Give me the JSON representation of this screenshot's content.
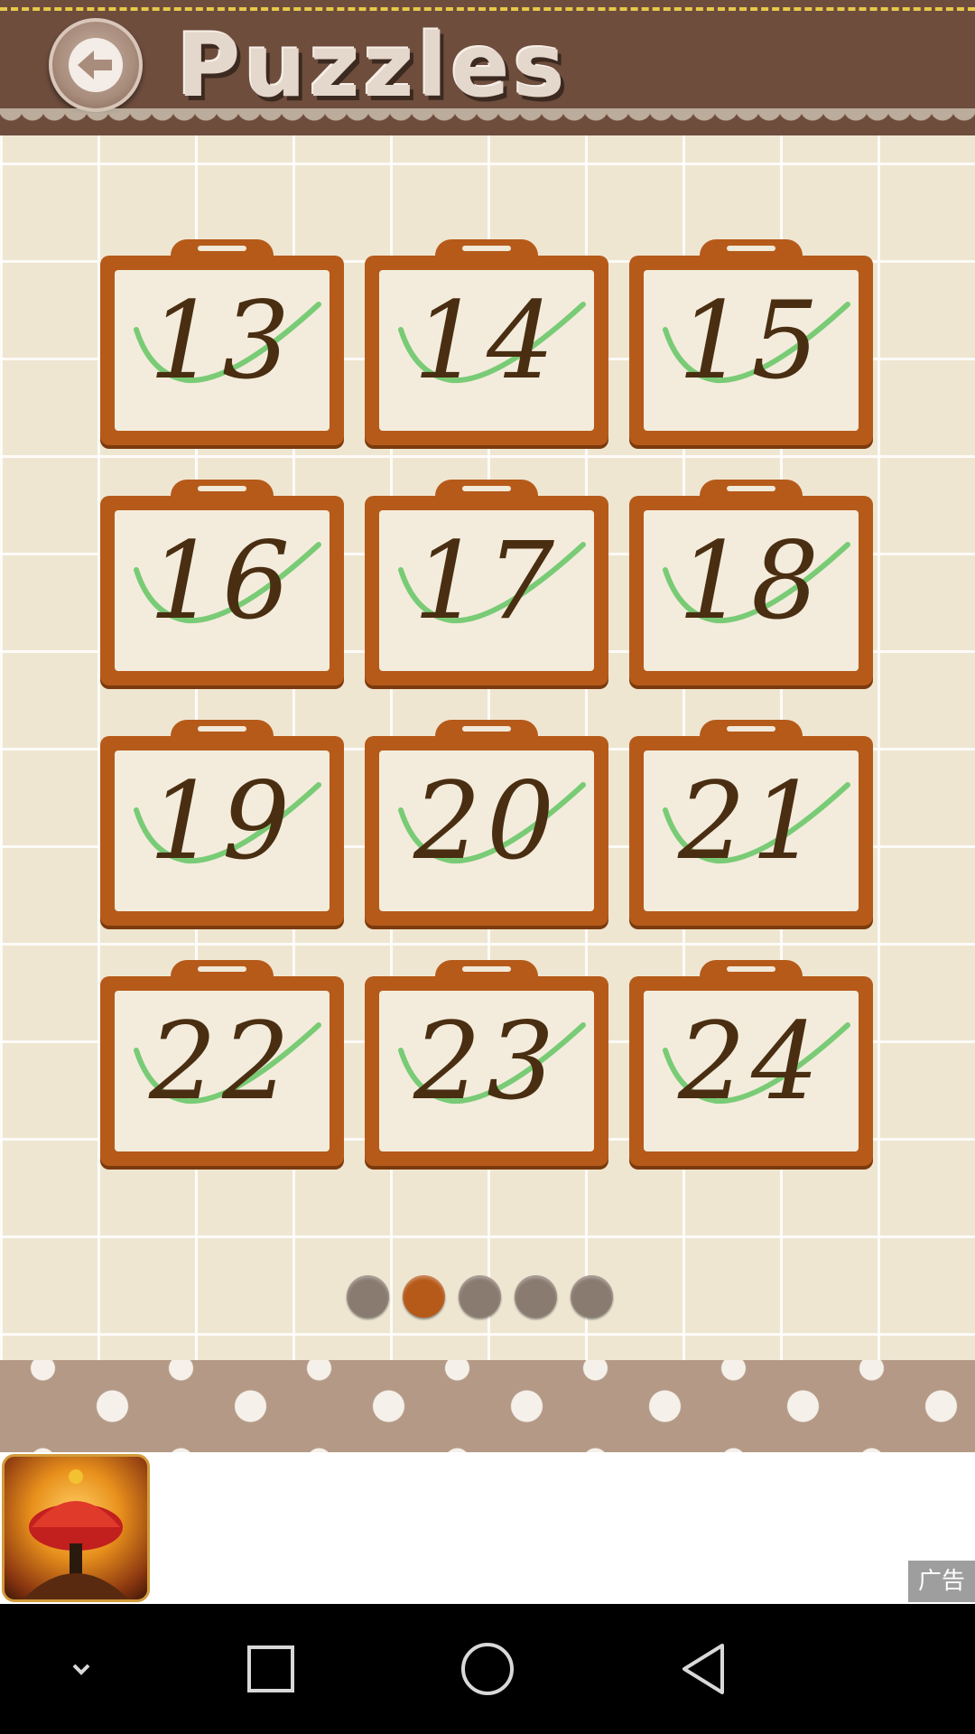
{
  "header": {
    "title": "Puzzles",
    "back_icon": "back-arrow-icon"
  },
  "puzzles": [
    {
      "number": "13",
      "completed": true
    },
    {
      "number": "14",
      "completed": true
    },
    {
      "number": "15",
      "completed": true
    },
    {
      "number": "16",
      "completed": true
    },
    {
      "number": "17",
      "completed": true
    },
    {
      "number": "18",
      "completed": true
    },
    {
      "number": "19",
      "completed": true
    },
    {
      "number": "20",
      "completed": true
    },
    {
      "number": "21",
      "completed": true
    },
    {
      "number": "22",
      "completed": true
    },
    {
      "number": "23",
      "completed": true
    },
    {
      "number": "24",
      "completed": true
    }
  ],
  "pagination": {
    "pages": 5,
    "current_page": 2
  },
  "ad": {
    "label": "广告",
    "icon": "game-ad-icon"
  },
  "colors": {
    "header_bg": "#6e4d3d",
    "tile_frame": "#b65a1a",
    "check": "#6cc86a",
    "dot_active": "#b65a1a",
    "dot_inactive": "#8a7b70"
  },
  "navbar": {
    "icons": [
      "chevron-down-icon",
      "square-recents-icon",
      "circle-home-icon",
      "triangle-back-icon"
    ]
  }
}
